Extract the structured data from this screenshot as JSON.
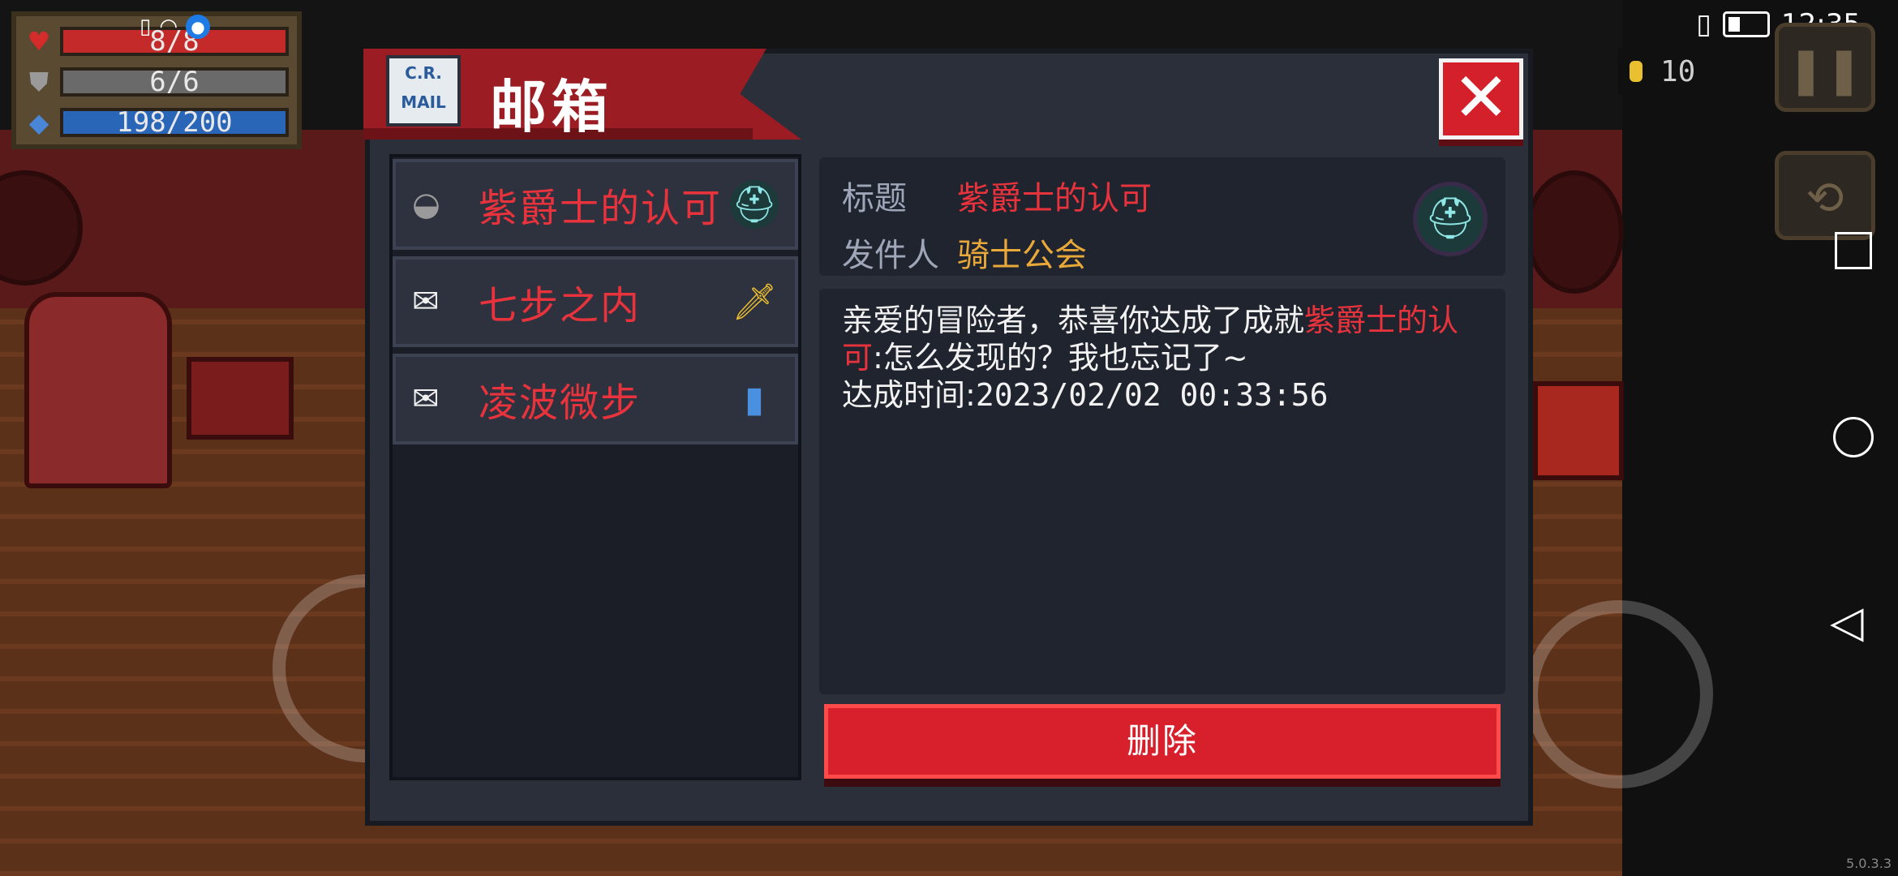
{
  "hud": {
    "hp": "8/8",
    "armor": "6/6",
    "energy": "198/200"
  },
  "status_bar": {
    "time": "12:35"
  },
  "coins": {
    "value": "10"
  },
  "dialog": {
    "title": "邮箱",
    "icon_text": "C.R.\nMAIL",
    "close_symbol": "✕"
  },
  "mail_list": [
    {
      "title": "紫爵士的认可",
      "read": true,
      "thumb": "knight-helmet-icon"
    },
    {
      "title": "七步之内",
      "read": false,
      "thumb": "sword-icon"
    },
    {
      "title": "凌波微步",
      "read": false,
      "thumb": "book-icon"
    }
  ],
  "detail": {
    "title_label": "标题",
    "title_value": "紫爵士的认可",
    "sender_label": "发件人",
    "sender_value": "骑士公会",
    "body_prefix": "亲爱的冒险者，恭喜你达成了成就",
    "body_highlight": "紫爵士的认可",
    "body_suffix": ":怎么发现的？我也忘记了~",
    "time_label": "达成时间:",
    "time_value": "2023/02/02 00:33:56",
    "delete_label": "删除"
  },
  "version": "5.0.3.3",
  "colors": {
    "accent_red": "#e8333d",
    "sender_gold": "#e8a93a",
    "panel": "#2b2f3a"
  }
}
